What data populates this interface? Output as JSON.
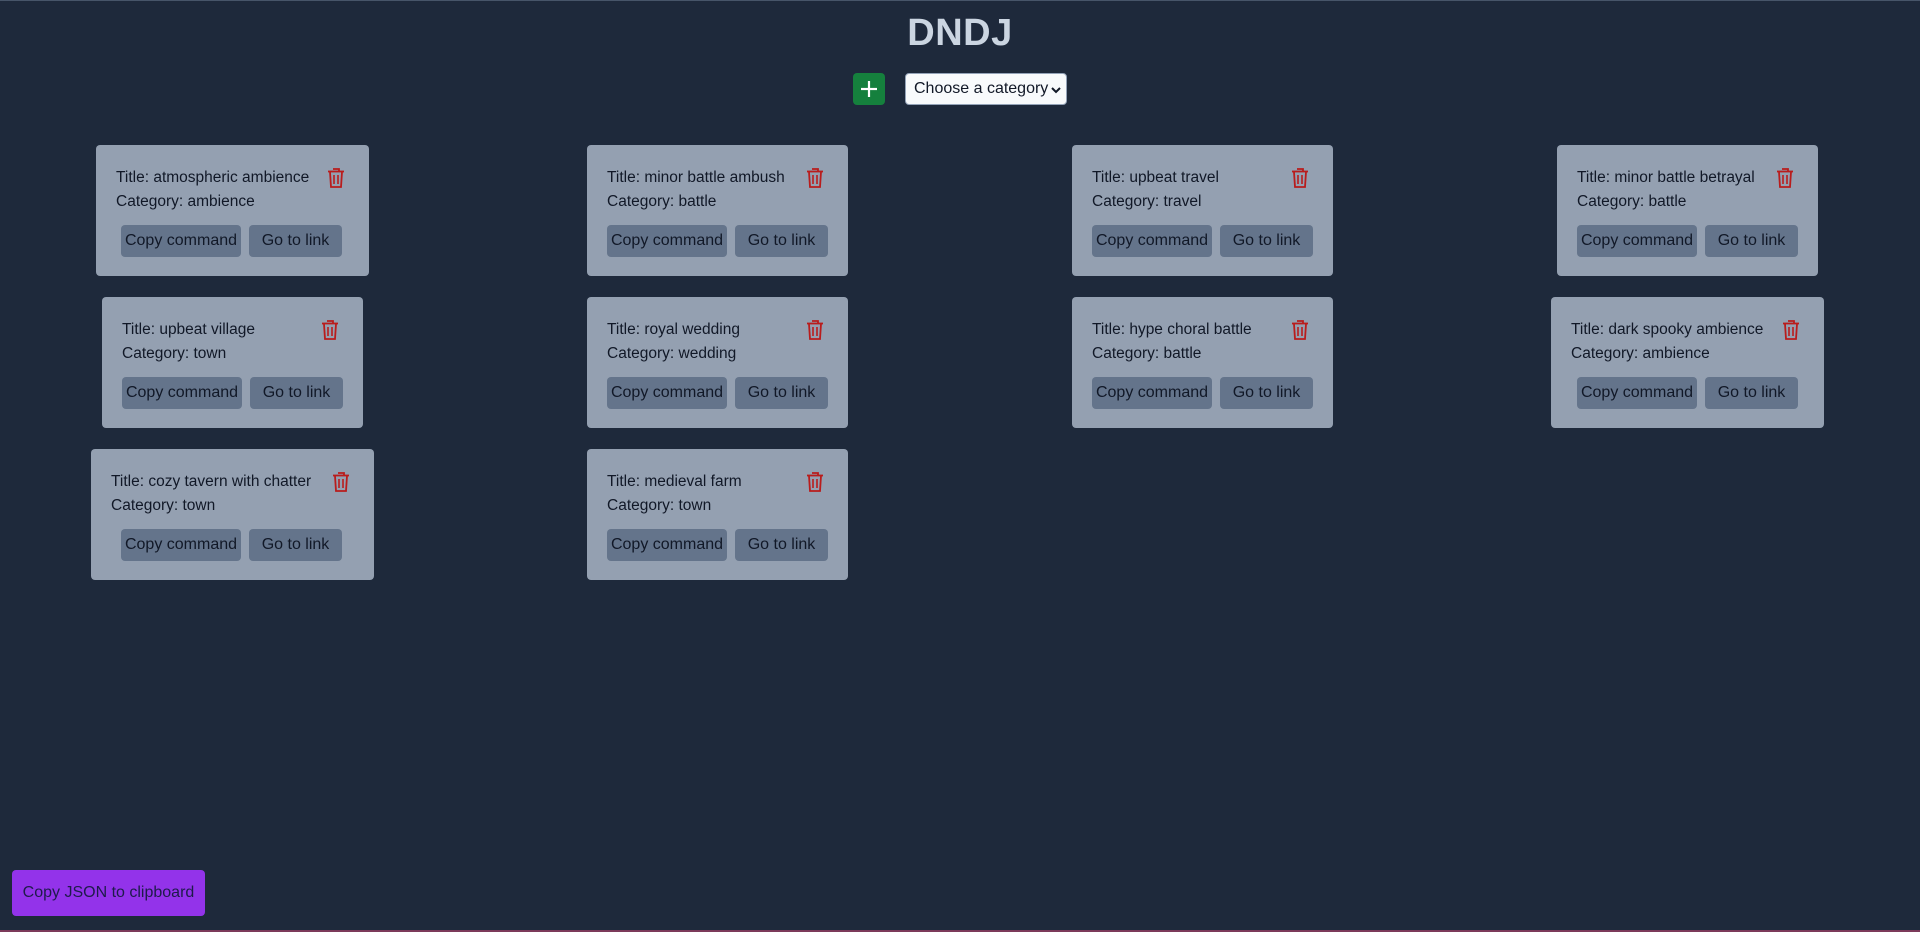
{
  "app": {
    "title": "DNDJ"
  },
  "toolbar": {
    "add_icon": "plus-icon",
    "category_select": {
      "selected": "Choose a category"
    }
  },
  "card_labels": {
    "copy_command": "Copy command",
    "go_to_link": "Go to link"
  },
  "tracks": [
    {
      "title": "Title: atmospheric ambience",
      "category": "Category: ambience"
    },
    {
      "title": "Title: minor battle ambush",
      "category": "Category: battle"
    },
    {
      "title": "Title: upbeat travel",
      "category": "Category: travel"
    },
    {
      "title": "Title: minor battle betrayal",
      "category": "Category: battle"
    },
    {
      "title": "Title: upbeat village",
      "category": "Category: town"
    },
    {
      "title": "Title: royal wedding",
      "category": "Category: wedding"
    },
    {
      "title": "Title: hype choral battle",
      "category": "Category: battle"
    },
    {
      "title": "Title: dark spooky ambience",
      "category": "Category: ambience"
    },
    {
      "title": "Title: cozy tavern with chatter",
      "category": "Category: town"
    },
    {
      "title": "Title: medieval farm",
      "category": "Category: town"
    }
  ],
  "footer": {
    "copy_json_label": "Copy JSON to clipboard"
  },
  "colors": {
    "background": "#1e293b",
    "card": "#94a0b1",
    "card_button": "#64748b",
    "add_button": "#15803d",
    "copy_json_button": "#9333ea",
    "trash_icon": "#b91c1c"
  }
}
